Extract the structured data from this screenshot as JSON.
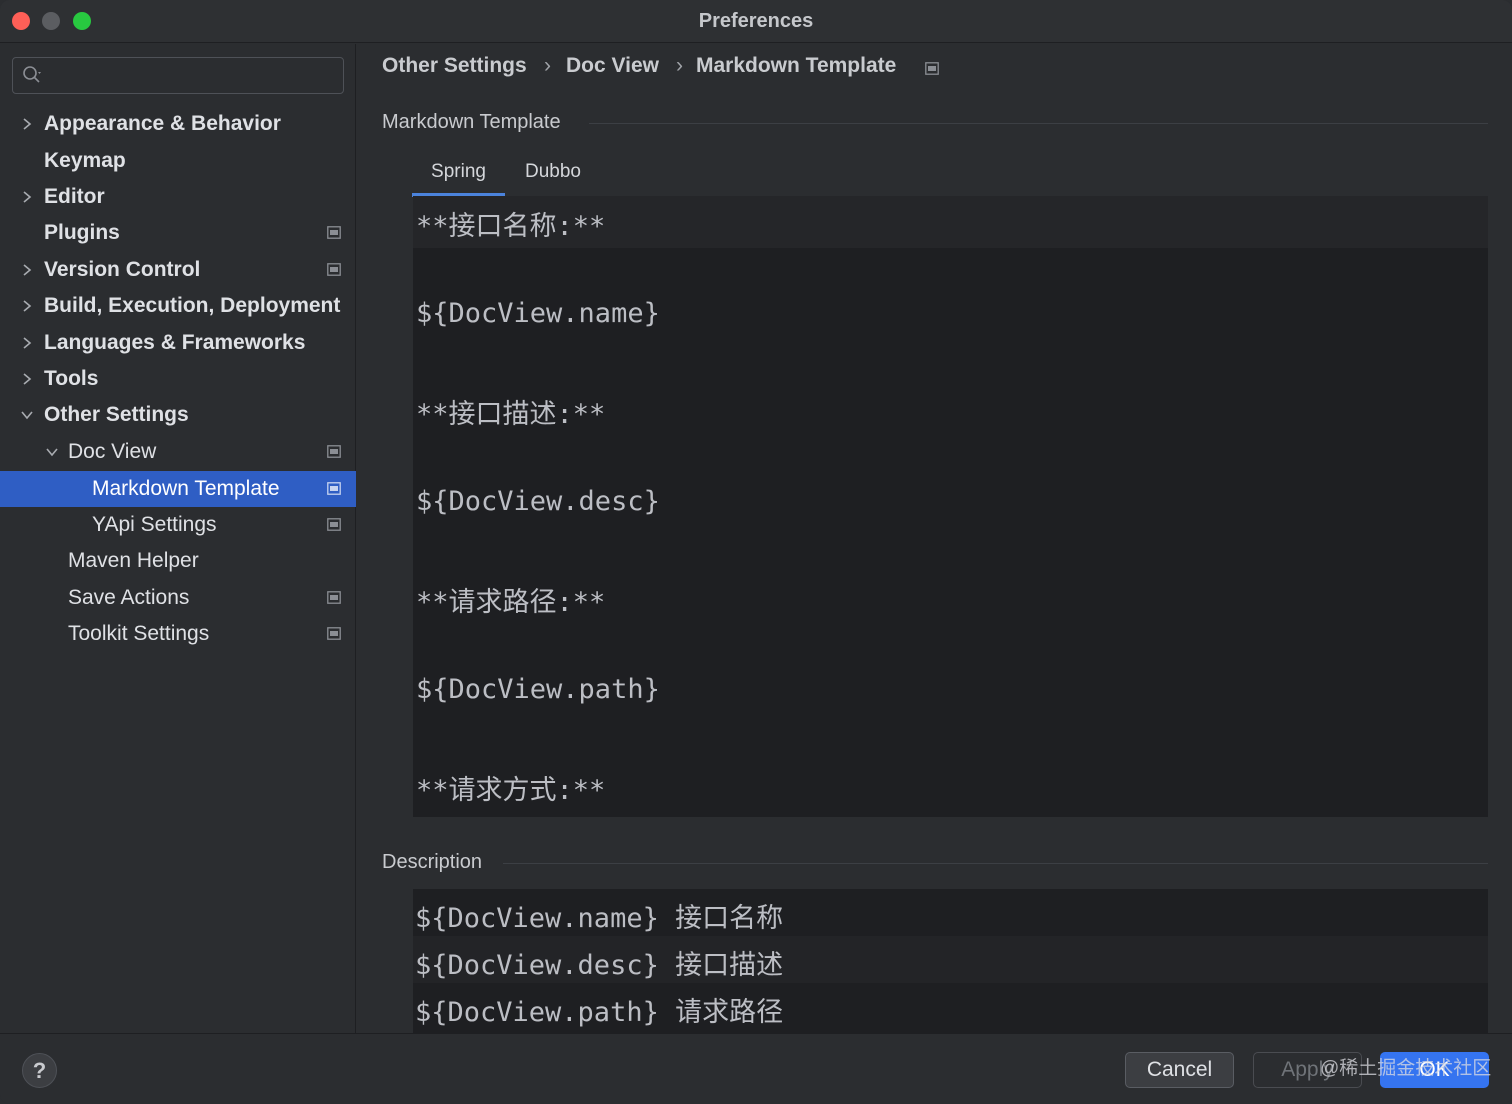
{
  "window": {
    "title": "Preferences"
  },
  "sidebar": {
    "search_placeholder": "",
    "items": [
      {
        "label": "Appearance & Behavior"
      },
      {
        "label": "Keymap"
      },
      {
        "label": "Editor"
      },
      {
        "label": "Plugins"
      },
      {
        "label": "Version Control"
      },
      {
        "label": "Build, Execution, Deployment"
      },
      {
        "label": "Languages & Frameworks"
      },
      {
        "label": "Tools"
      },
      {
        "label": "Other Settings"
      },
      {
        "label": "Doc View"
      },
      {
        "label": "Markdown Template"
      },
      {
        "label": "YApi Settings"
      },
      {
        "label": "Maven Helper"
      },
      {
        "label": "Save Actions"
      },
      {
        "label": "Toolkit Settings"
      }
    ]
  },
  "breadcrumb": {
    "items": [
      "Other Settings",
      "Doc View",
      "Markdown Template"
    ],
    "separator": "›"
  },
  "template_section": {
    "title": "Markdown Template",
    "tabs": [
      {
        "label": "Spring"
      },
      {
        "label": "Dubbo"
      }
    ],
    "active_tab": "Spring",
    "editor_lines": [
      "**接口名称:**",
      "${DocView.name}",
      "**接口描述:**",
      "${DocView.desc}",
      "**请求路径:**",
      "${DocView.path}",
      "**请求方式:**"
    ]
  },
  "description_section": {
    "title": "Description",
    "rows": [
      "${DocView.name} 接口名称",
      "${DocView.desc} 接口描述",
      "${DocView.path} 请求路径"
    ]
  },
  "footer": {
    "help_label": "?",
    "cancel_label": "Cancel",
    "apply_label": "Apply",
    "ok_label": "OK",
    "watermark": "@稀土掘金技术社区"
  },
  "colors": {
    "selection": "#2f5ec4",
    "accent": "#3574f0",
    "tab_underline": "#4b83dc"
  }
}
